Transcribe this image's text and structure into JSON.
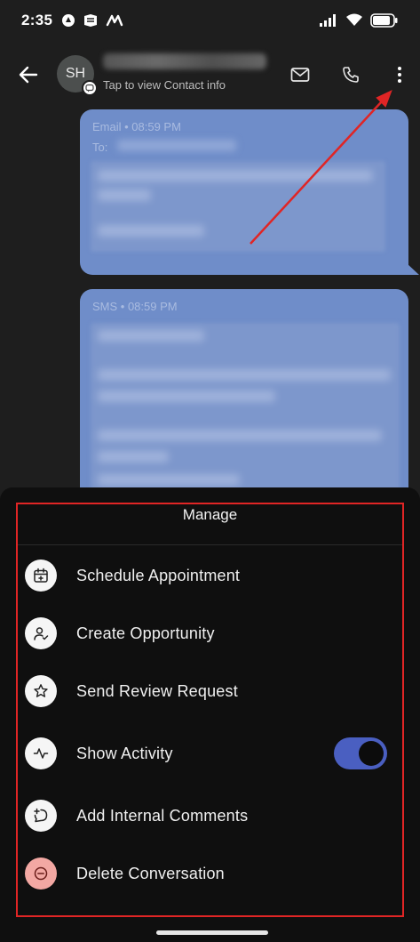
{
  "status_bar": {
    "time": "2:35"
  },
  "header": {
    "avatar_initials": "SH",
    "subtitle": "Tap to view Contact info"
  },
  "messages": [
    {
      "channel": "Email",
      "time": "08:59 PM",
      "meta": "Email • 08:59 PM",
      "to_label": "To:"
    },
    {
      "channel": "SMS",
      "time": "08:59 PM",
      "meta": "SMS • 08:59 PM"
    }
  ],
  "sheet": {
    "title": "Manage",
    "items": [
      {
        "label": "Schedule Appointment",
        "icon": "calendar-plus-icon"
      },
      {
        "label": "Create Opportunity",
        "icon": "user-check-icon"
      },
      {
        "label": "Send Review Request",
        "icon": "star-icon"
      },
      {
        "label": "Show Activity",
        "icon": "activity-icon",
        "toggle_on": true
      },
      {
        "label": "Add Internal Comments",
        "icon": "comment-plus-icon"
      },
      {
        "label": "Delete Conversation",
        "icon": "minus-circle-icon",
        "danger": true
      }
    ]
  },
  "colors": {
    "background": "#1e1e1e",
    "bubble": "#6f8dc9",
    "sheet": "#0f0f0f",
    "toggle_on": "#4a5fc1",
    "danger_icon_bg": "#f3a8a3",
    "annotation": "#e02525"
  }
}
